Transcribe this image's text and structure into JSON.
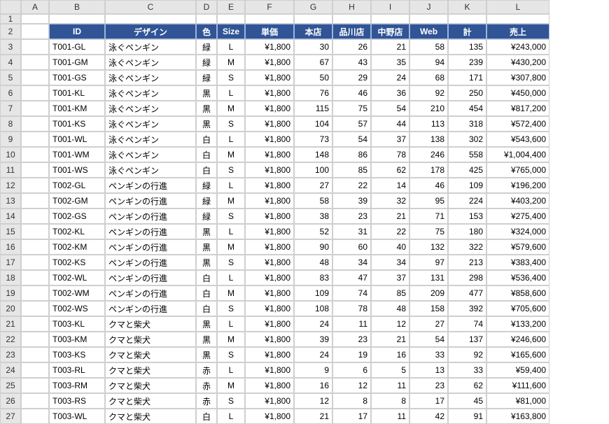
{
  "cols": [
    "A",
    "B",
    "C",
    "D",
    "E",
    "F",
    "G",
    "H",
    "I",
    "J",
    "K",
    "L"
  ],
  "row_numbers": [
    1,
    2,
    3,
    4,
    5,
    6,
    7,
    8,
    9,
    10,
    11,
    12,
    13,
    14,
    15,
    16,
    17,
    18,
    19,
    20,
    21,
    22,
    23,
    24,
    25,
    26,
    27
  ],
  "headers": {
    "B": "ID",
    "C": "デザイン",
    "D": "色",
    "E": "Size",
    "F": "単価",
    "G": "本店",
    "H": "品川店",
    "I": "中野店",
    "J": "Web",
    "K": "計",
    "L": "売上"
  },
  "rows": [
    {
      "id": "T001-GL",
      "design": "泳ぐペンギン",
      "color": "緑",
      "size": "L",
      "unit": "¥1,800",
      "g": 30,
      "h": 26,
      "i": 21,
      "j": 58,
      "k": 135,
      "sales": "¥243,000"
    },
    {
      "id": "T001-GM",
      "design": "泳ぐペンギン",
      "color": "緑",
      "size": "M",
      "unit": "¥1,800",
      "g": 67,
      "h": 43,
      "i": 35,
      "j": 94,
      "k": 239,
      "sales": "¥430,200"
    },
    {
      "id": "T001-GS",
      "design": "泳ぐペンギン",
      "color": "緑",
      "size": "S",
      "unit": "¥1,800",
      "g": 50,
      "h": 29,
      "i": 24,
      "j": 68,
      "k": 171,
      "sales": "¥307,800"
    },
    {
      "id": "T001-KL",
      "design": "泳ぐペンギン",
      "color": "黒",
      "size": "L",
      "unit": "¥1,800",
      "g": 76,
      "h": 46,
      "i": 36,
      "j": 92,
      "k": 250,
      "sales": "¥450,000"
    },
    {
      "id": "T001-KM",
      "design": "泳ぐペンギン",
      "color": "黒",
      "size": "M",
      "unit": "¥1,800",
      "g": 115,
      "h": 75,
      "i": 54,
      "j": 210,
      "k": 454,
      "sales": "¥817,200"
    },
    {
      "id": "T001-KS",
      "design": "泳ぐペンギン",
      "color": "黒",
      "size": "S",
      "unit": "¥1,800",
      "g": 104,
      "h": 57,
      "i": 44,
      "j": 113,
      "k": 318,
      "sales": "¥572,400"
    },
    {
      "id": "T001-WL",
      "design": "泳ぐペンギン",
      "color": "白",
      "size": "L",
      "unit": "¥1,800",
      "g": 73,
      "h": 54,
      "i": 37,
      "j": 138,
      "k": 302,
      "sales": "¥543,600"
    },
    {
      "id": "T001-WM",
      "design": "泳ぐペンギン",
      "color": "白",
      "size": "M",
      "unit": "¥1,800",
      "g": 148,
      "h": 86,
      "i": 78,
      "j": 246,
      "k": 558,
      "sales": "¥1,004,400"
    },
    {
      "id": "T001-WS",
      "design": "泳ぐペンギン",
      "color": "白",
      "size": "S",
      "unit": "¥1,800",
      "g": 100,
      "h": 85,
      "i": 62,
      "j": 178,
      "k": 425,
      "sales": "¥765,000"
    },
    {
      "id": "T002-GL",
      "design": "ペンギンの行進",
      "color": "緑",
      "size": "L",
      "unit": "¥1,800",
      "g": 27,
      "h": 22,
      "i": 14,
      "j": 46,
      "k": 109,
      "sales": "¥196,200"
    },
    {
      "id": "T002-GM",
      "design": "ペンギンの行進",
      "color": "緑",
      "size": "M",
      "unit": "¥1,800",
      "g": 58,
      "h": 39,
      "i": 32,
      "j": 95,
      "k": 224,
      "sales": "¥403,200"
    },
    {
      "id": "T002-GS",
      "design": "ペンギンの行進",
      "color": "緑",
      "size": "S",
      "unit": "¥1,800",
      "g": 38,
      "h": 23,
      "i": 21,
      "j": 71,
      "k": 153,
      "sales": "¥275,400"
    },
    {
      "id": "T002-KL",
      "design": "ペンギンの行進",
      "color": "黒",
      "size": "L",
      "unit": "¥1,800",
      "g": 52,
      "h": 31,
      "i": 22,
      "j": 75,
      "k": 180,
      "sales": "¥324,000"
    },
    {
      "id": "T002-KM",
      "design": "ペンギンの行進",
      "color": "黒",
      "size": "M",
      "unit": "¥1,800",
      "g": 90,
      "h": 60,
      "i": 40,
      "j": 132,
      "k": 322,
      "sales": "¥579,600"
    },
    {
      "id": "T002-KS",
      "design": "ペンギンの行進",
      "color": "黒",
      "size": "S",
      "unit": "¥1,800",
      "g": 48,
      "h": 34,
      "i": 34,
      "j": 97,
      "k": 213,
      "sales": "¥383,400"
    },
    {
      "id": "T002-WL",
      "design": "ペンギンの行進",
      "color": "白",
      "size": "L",
      "unit": "¥1,800",
      "g": 83,
      "h": 47,
      "i": 37,
      "j": 131,
      "k": 298,
      "sales": "¥536,400"
    },
    {
      "id": "T002-WM",
      "design": "ペンギンの行進",
      "color": "白",
      "size": "M",
      "unit": "¥1,800",
      "g": 109,
      "h": 74,
      "i": 85,
      "j": 209,
      "k": 477,
      "sales": "¥858,600"
    },
    {
      "id": "T002-WS",
      "design": "ペンギンの行進",
      "color": "白",
      "size": "S",
      "unit": "¥1,800",
      "g": 108,
      "h": 78,
      "i": 48,
      "j": 158,
      "k": 392,
      "sales": "¥705,600"
    },
    {
      "id": "T003-KL",
      "design": "クマと柴犬",
      "color": "黒",
      "size": "L",
      "unit": "¥1,800",
      "g": 24,
      "h": 11,
      "i": 12,
      "j": 27,
      "k": 74,
      "sales": "¥133,200"
    },
    {
      "id": "T003-KM",
      "design": "クマと柴犬",
      "color": "黒",
      "size": "M",
      "unit": "¥1,800",
      "g": 39,
      "h": 23,
      "i": 21,
      "j": 54,
      "k": 137,
      "sales": "¥246,600"
    },
    {
      "id": "T003-KS",
      "design": "クマと柴犬",
      "color": "黒",
      "size": "S",
      "unit": "¥1,800",
      "g": 24,
      "h": 19,
      "i": 16,
      "j": 33,
      "k": 92,
      "sales": "¥165,600"
    },
    {
      "id": "T003-RL",
      "design": "クマと柴犬",
      "color": "赤",
      "size": "L",
      "unit": "¥1,800",
      "g": 9,
      "h": 6,
      "i": 5,
      "j": 13,
      "k": 33,
      "sales": "¥59,400"
    },
    {
      "id": "T003-RM",
      "design": "クマと柴犬",
      "color": "赤",
      "size": "M",
      "unit": "¥1,800",
      "g": 16,
      "h": 12,
      "i": 11,
      "j": 23,
      "k": 62,
      "sales": "¥111,600"
    },
    {
      "id": "T003-RS",
      "design": "クマと柴犬",
      "color": "赤",
      "size": "S",
      "unit": "¥1,800",
      "g": 12,
      "h": 8,
      "i": 8,
      "j": 17,
      "k": 45,
      "sales": "¥81,000"
    },
    {
      "id": "T003-WL",
      "design": "クマと柴犬",
      "color": "白",
      "size": "L",
      "unit": "¥1,800",
      "g": 21,
      "h": 17,
      "i": 11,
      "j": 42,
      "k": 91,
      "sales": "¥163,800"
    }
  ]
}
